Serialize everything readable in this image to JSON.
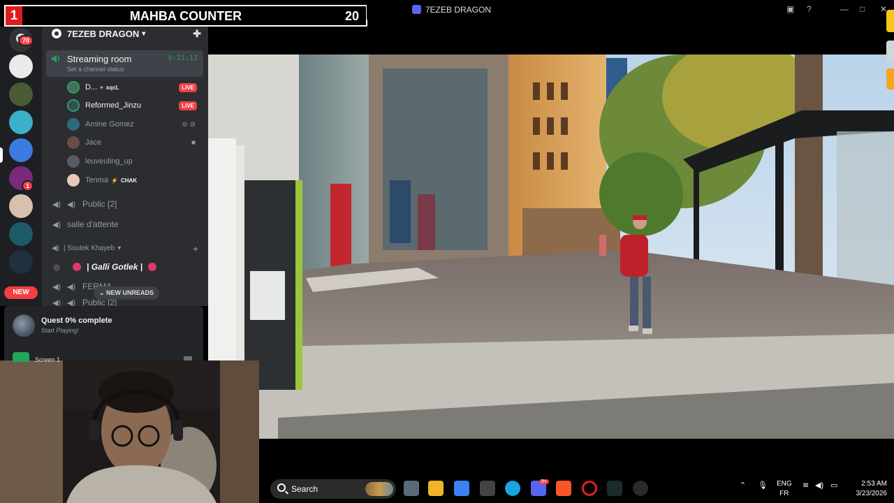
{
  "window": {
    "title": "7EZEB DRAGON"
  },
  "counter": {
    "number": "1",
    "title": "MAHBA COUNTER",
    "count": "20"
  },
  "rail": {
    "mentions_badge": "70",
    "unread_badge": "1",
    "new_pill": "NEW"
  },
  "guild": {
    "name": "7EZEB DRAGON"
  },
  "active_channel": {
    "name": "Streaming room",
    "status": "Set a channel status",
    "timer": "6:21:12"
  },
  "voice_users": [
    {
      "name": "D...",
      "tag": "xqcL",
      "live": "LIVE"
    },
    {
      "name": "Reformed_Jinzu",
      "live": "LIVE"
    },
    {
      "name": "Amine Gomez"
    },
    {
      "name": "Jace"
    },
    {
      "name": "leuveuling_up"
    },
    {
      "name": "Tenma",
      "tag": "CHAK"
    }
  ],
  "channels": {
    "public": "Public [2]",
    "waiting": "salle d'attente",
    "category": "| Soutek Khayeb",
    "galli": "| Galli Gotlek |",
    "partial1": "FERMA",
    "partial2": "Public [2]"
  },
  "new_unreads": "NEW UNREADS",
  "quest": {
    "title": "Quest 0% complete",
    "subtitle": "Start Playing!"
  },
  "under_quest": {
    "text": "Screen 1"
  },
  "taskbar": {
    "search_placeholder": "Search",
    "lang_line1": "ENG",
    "lang_line2": "FR",
    "time": "2:53 AM",
    "date": "3/23/2026",
    "discord_badge": "9+"
  }
}
